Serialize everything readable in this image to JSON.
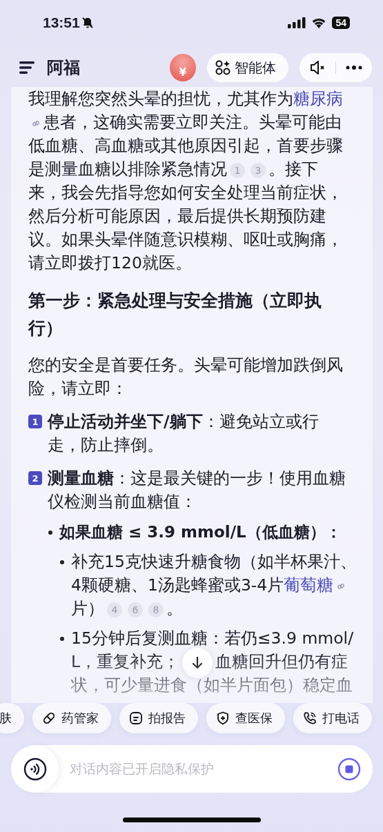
{
  "status_bar": {
    "time": "13:51",
    "battery": "54"
  },
  "header": {
    "title": "阿福",
    "badge_symbol": "¥",
    "agent_button": "智能体"
  },
  "message": {
    "intro": [
      {
        "kind": "text",
        "text": "我理解您突然头晕的担忧，尤其作为"
      },
      {
        "kind": "link",
        "text": "糖尿病"
      },
      {
        "kind": "text",
        "text": "患者，这确实需要立即关注。头晕可能由低血糖、高血糖或其他原因引起，首要步骤是测量血糖以排除紧急情况"
      },
      {
        "kind": "cite",
        "text": "1"
      },
      {
        "kind": "cite",
        "text": "3"
      },
      {
        "kind": "text",
        "text": "。接下来，我会先指导您如何安全处理当前症状，然后分析可能原因，最后提供长期预防建议。如果头晕伴随意识模糊、呕吐或胸痛，请立即拨打120就医。"
      }
    ],
    "heading": "第一步：紧急处理与安全措施（立即执行）",
    "paragraph": "您的安全是首要任务。头晕可能增加跌倒风险，请立即：",
    "steps": [
      {
        "number": "1",
        "title": "停止活动并坐下/躺下",
        "text": "：避免站立或行走，防止摔倒。"
      },
      {
        "number": "2",
        "title": "测量血糖",
        "text": "：这是最关键的一步！使用血糖仪检测当前血糖值：",
        "bullets": [
          {
            "text": "如果血糖 ≤ 3.9 mmol/L（低血糖）：",
            "items": [
              [
                {
                  "kind": "text",
                  "text": "补充15克快速升糖食物（如半杯果汁、4颗硬糖、1汤匙蜂蜜或3-4片"
                },
                {
                  "kind": "link",
                  "text": "葡萄糖"
                },
                {
                  "kind": "text",
                  "text": "片）"
                },
                {
                  "kind": "cite",
                  "text": "4"
                },
                {
                  "kind": "cite",
                  "text": "6"
                },
                {
                  "kind": "cite",
                  "text": "8"
                },
                {
                  "kind": "text",
                  "text": "。"
                }
              ],
              [
                {
                  "kind": "text",
                  "text": "15分钟后复测血糖：若仍≤3.9 mmol/L，重复补充；"
                },
                {
                  "kind": "text",
                  "text": "血糖回升但仍有症状，可少量进食（如半片面包）稳定血"
                }
              ]
            ]
          }
        ]
      }
    ]
  },
  "shortcuts": [
    "肤",
    "药管家",
    "拍报告",
    "查医保",
    "打电话"
  ],
  "input": {
    "placeholder": "对话内容已开启隐私保护"
  }
}
